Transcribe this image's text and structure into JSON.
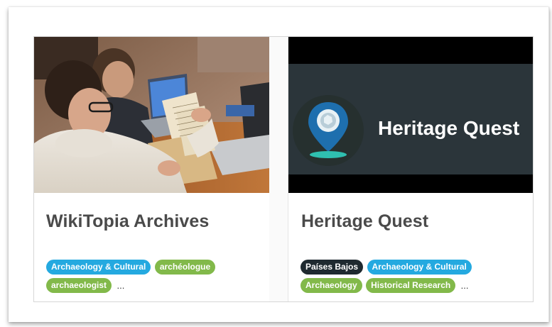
{
  "cards": [
    {
      "title": "WikiTopia Archives",
      "image": "photo of researchers reviewing archival documents",
      "tags": [
        {
          "label": "Archaeology & Cultural",
          "color": "#24a9e0"
        },
        {
          "label": "archéologue",
          "color": "#82b94a"
        },
        {
          "label": "archaeologist",
          "color": "#82b94a"
        }
      ],
      "more": "..."
    },
    {
      "title": "Heritage Quest",
      "image_logo_text": "Heritage Quest",
      "tags": [
        {
          "label": "Países Bajos",
          "color": "#1f2a30"
        },
        {
          "label": "Archaeology & Cultural",
          "color": "#24a9e0"
        },
        {
          "label": "Archaeology",
          "color": "#82b94a"
        },
        {
          "label": "Historical Research",
          "color": "#82b94a"
        }
      ],
      "more": "..."
    }
  ],
  "colors": {
    "tag_blue": "#24a9e0",
    "tag_green": "#82b94a",
    "tag_dark": "#1f2a30",
    "logo_bg": "#2b353a",
    "title_text": "#4a4a4a"
  }
}
